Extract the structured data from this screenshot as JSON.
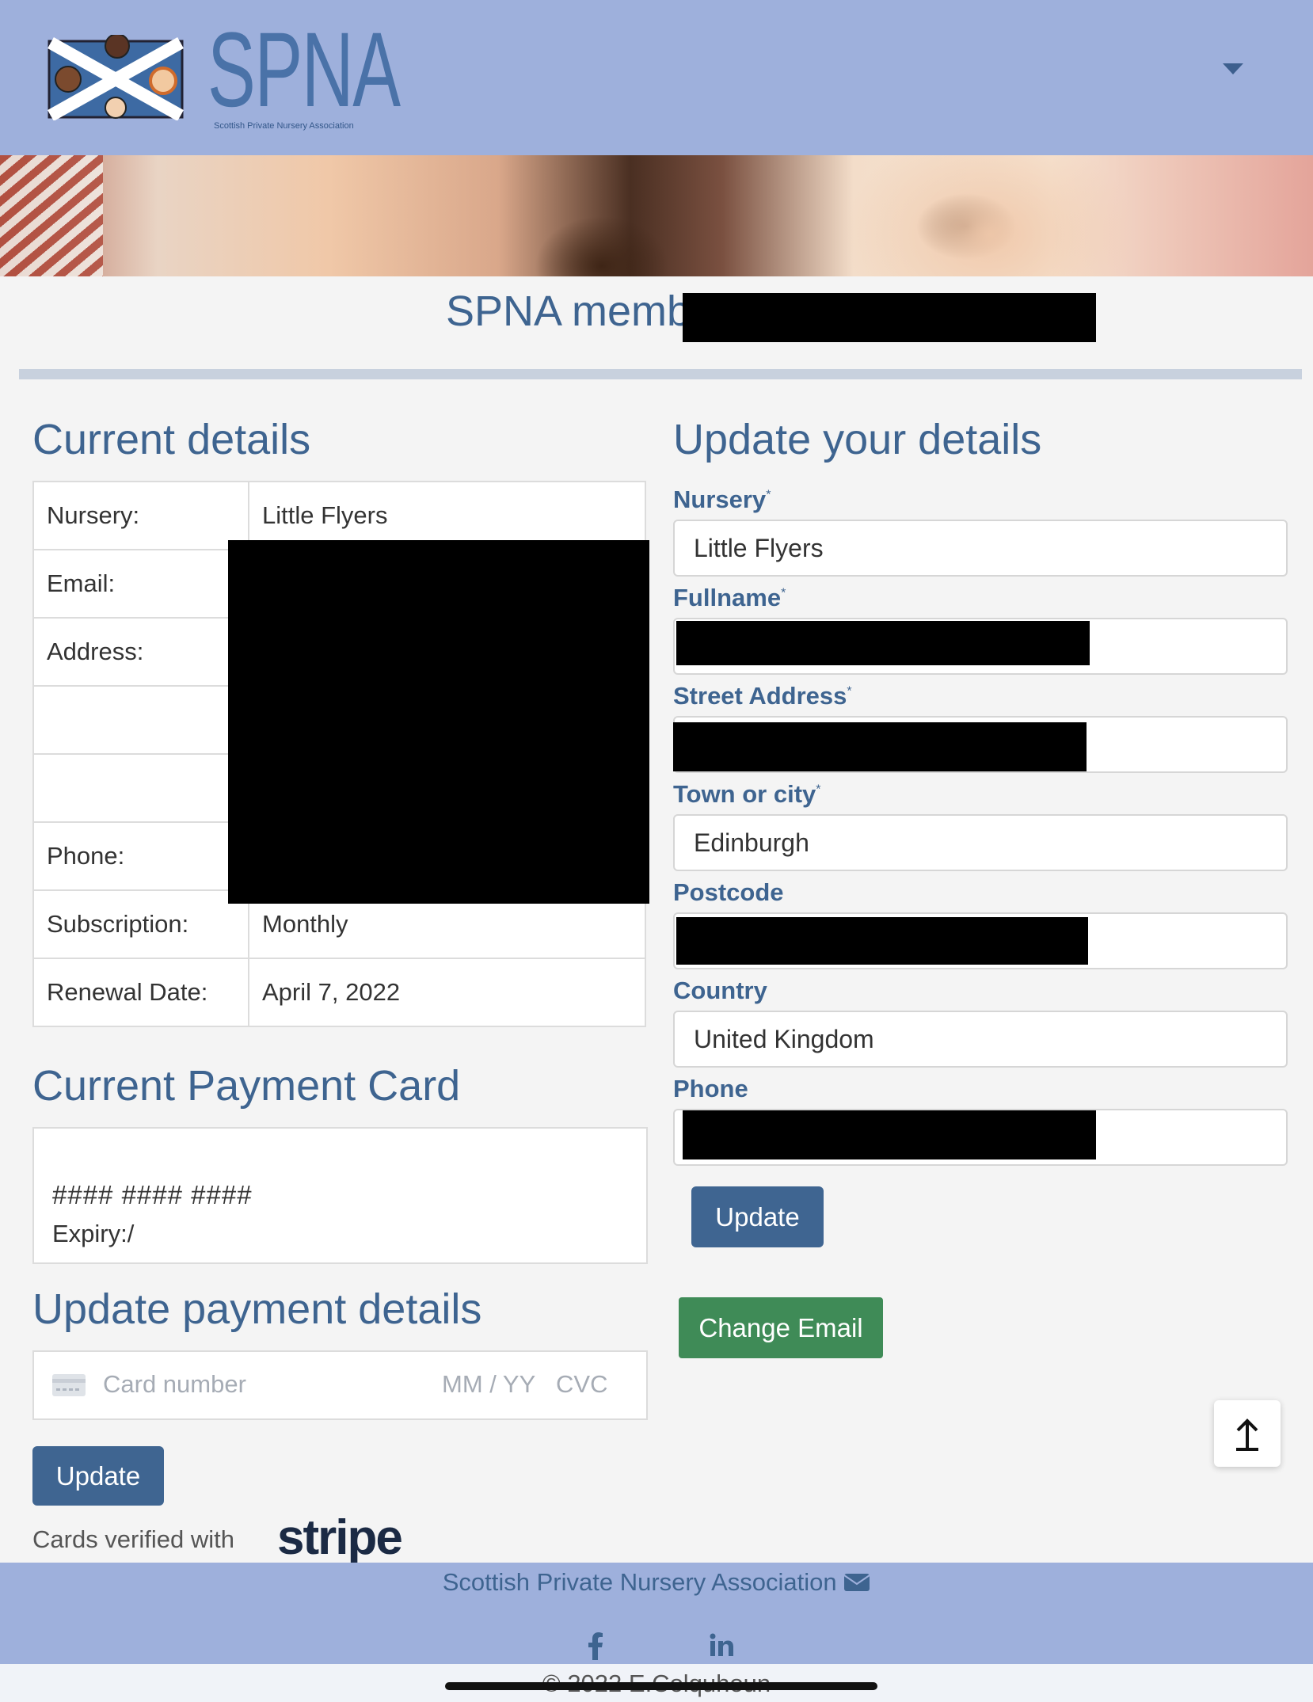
{
  "header": {
    "logo_text": "SPNA",
    "logo_subtitle": "Scottish Private Nursery Association"
  },
  "member": {
    "title_label": "SPNA member: "
  },
  "current_details": {
    "heading": "Current details",
    "rows": [
      {
        "label": "Nursery:",
        "value": "Little Flyers"
      },
      {
        "label": "Email:",
        "value": ""
      },
      {
        "label": "Address:",
        "value": ""
      },
      {
        "label": "",
        "value": ""
      },
      {
        "label": "",
        "value": ""
      },
      {
        "label": "Phone:",
        "value": ""
      },
      {
        "label": "Subscription:",
        "value": "Monthly"
      },
      {
        "label": "Renewal Date:",
        "value": "April 7, 2022"
      }
    ]
  },
  "payment_card": {
    "heading": "Current Payment Card",
    "number": "#### #### ####",
    "expiry": "Expiry:/"
  },
  "update_payment": {
    "heading": "Update payment details",
    "card_placeholder": "Card number",
    "date_placeholder": "MM / YY",
    "cvc_placeholder": "CVC",
    "button": "Update",
    "verified_text": "Cards verified with",
    "stripe_logo": "stripe"
  },
  "update_details": {
    "heading": "Update your details",
    "fields": [
      {
        "label": "Nursery",
        "required": "*",
        "value": "Little Flyers"
      },
      {
        "label": "Fullname",
        "required": "*",
        "value": ""
      },
      {
        "label": "Street Address",
        "required": "*",
        "value": ""
      },
      {
        "label": "Town or city",
        "required": "*",
        "value": "Edinburgh"
      },
      {
        "label": "Postcode",
        "required": "",
        "value": ""
      },
      {
        "label": "Country",
        "required": "",
        "value": "United Kingdom"
      },
      {
        "label": "Phone",
        "required": "",
        "value": ""
      }
    ],
    "update_button": "Update",
    "change_email_button": "Change Email"
  },
  "footer": {
    "org_name": "Scottish Private Nursery Association",
    "copyright": "© 2022 E.Colquhoun"
  },
  "colors": {
    "header_bg": "#9eb0dc",
    "heading": "#3e6490",
    "primary_button": "#3f6591",
    "success_button": "#3f8b57"
  },
  "icons": [
    "chevron-down-icon",
    "arrow-up-icon",
    "envelope-icon",
    "facebook-icon",
    "linkedin-icon",
    "credit-card-icon"
  ]
}
